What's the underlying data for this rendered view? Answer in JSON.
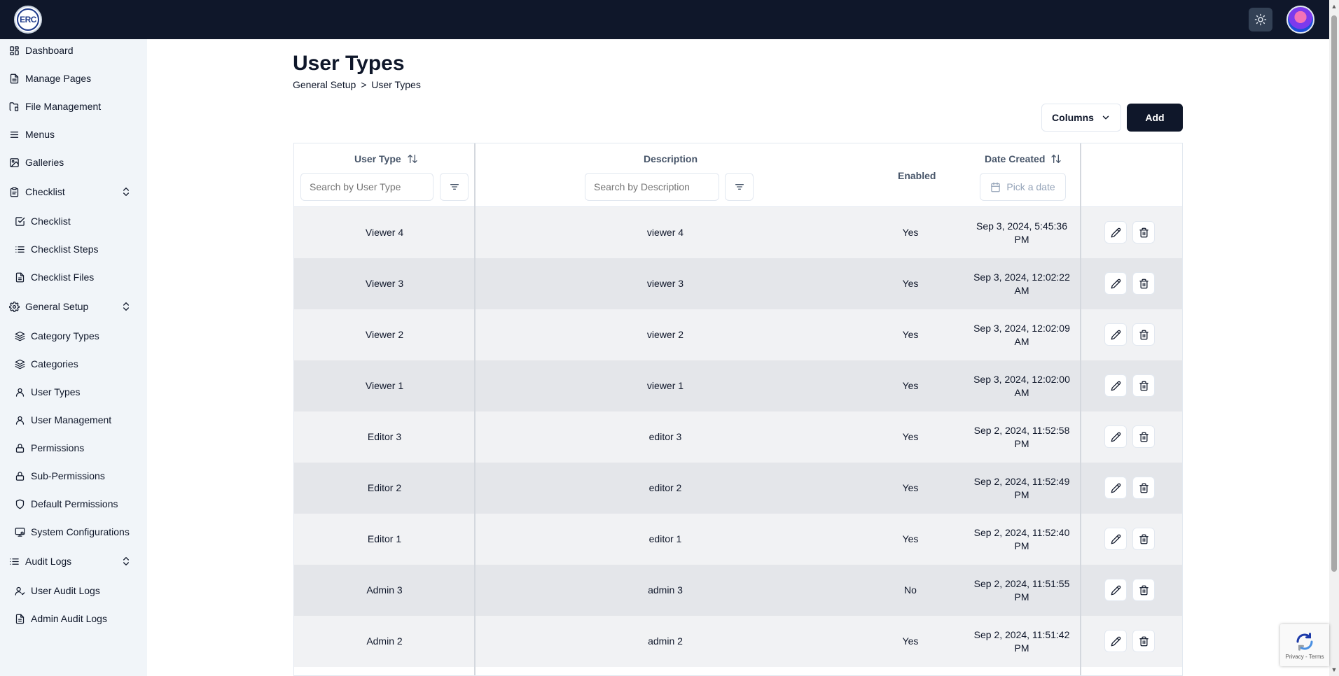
{
  "header": {
    "logo_text": "ERC"
  },
  "sidebar": {
    "items": [
      {
        "label": "Dashboard",
        "icon": "dashboard-icon"
      },
      {
        "label": "Manage Pages",
        "icon": "file-text-icon"
      },
      {
        "label": "File Management",
        "icon": "folder-file-icon"
      },
      {
        "label": "Menus",
        "icon": "menu-icon"
      },
      {
        "label": "Galleries",
        "icon": "image-icon"
      },
      {
        "label": "Checklist",
        "icon": "clipboard-icon",
        "expandable": true
      },
      {
        "label": "Checklist",
        "icon": "check-square-icon"
      },
      {
        "label": "Checklist Steps",
        "icon": "list-icon"
      },
      {
        "label": "Checklist Files",
        "icon": "file-icon"
      },
      {
        "label": "General Setup",
        "icon": "gear-icon",
        "expandable": true
      },
      {
        "label": "Category Types",
        "icon": "layers-icon"
      },
      {
        "label": "Categories",
        "icon": "layers-icon"
      },
      {
        "label": "User Types",
        "icon": "user-icon"
      },
      {
        "label": "User Management",
        "icon": "user-icon"
      },
      {
        "label": "Permissions",
        "icon": "lock-icon"
      },
      {
        "label": "Sub-Permissions",
        "icon": "lock-icon"
      },
      {
        "label": "Default Permissions",
        "icon": "shield-icon"
      },
      {
        "label": "System Configurations",
        "icon": "monitor-cog-icon"
      },
      {
        "label": "Audit Logs",
        "icon": "list-icon",
        "expandable": true
      },
      {
        "label": "User Audit Logs",
        "icon": "user-check-icon"
      },
      {
        "label": "Admin Audit Logs",
        "icon": "file-icon"
      }
    ]
  },
  "page": {
    "title": "User Types",
    "breadcrumb": {
      "parent": "General Setup",
      "separator": ">",
      "current": "User Types"
    }
  },
  "toolbar": {
    "columns_label": "Columns",
    "add_label": "Add"
  },
  "table": {
    "headers": {
      "user_type": "User Type",
      "description": "Description",
      "enabled": "Enabled",
      "date_created": "Date Created"
    },
    "filters": {
      "user_type_placeholder": "Search by User Type",
      "description_placeholder": "Search by Description",
      "date_placeholder": "Pick a date"
    },
    "rows": [
      {
        "user_type": "Viewer 4",
        "description": "viewer 4",
        "enabled": "Yes",
        "date_line1": "Sep 3, 2024, 5:45:36",
        "date_line2": "PM"
      },
      {
        "user_type": "Viewer 3",
        "description": "viewer 3",
        "enabled": "Yes",
        "date_line1": "Sep 3, 2024, 12:02:22",
        "date_line2": "AM"
      },
      {
        "user_type": "Viewer 2",
        "description": "viewer 2",
        "enabled": "Yes",
        "date_line1": "Sep 3, 2024, 12:02:09",
        "date_line2": "AM"
      },
      {
        "user_type": "Viewer 1",
        "description": "viewer 1",
        "enabled": "Yes",
        "date_line1": "Sep 3, 2024, 12:02:00",
        "date_line2": "AM"
      },
      {
        "user_type": "Editor 3",
        "description": "editor 3",
        "enabled": "Yes",
        "date_line1": "Sep 2, 2024, 11:52:58",
        "date_line2": "PM"
      },
      {
        "user_type": "Editor 2",
        "description": "editor 2",
        "enabled": "Yes",
        "date_line1": "Sep 2, 2024, 11:52:49",
        "date_line2": "PM"
      },
      {
        "user_type": "Editor 1",
        "description": "editor 1",
        "enabled": "Yes",
        "date_line1": "Sep 2, 2024, 11:52:40",
        "date_line2": "PM"
      },
      {
        "user_type": "Admin 3",
        "description": "admin 3",
        "enabled": "No",
        "date_line1": "Sep 2, 2024, 11:51:55",
        "date_line2": "PM"
      },
      {
        "user_type": "Admin 2",
        "description": "admin 2",
        "enabled": "Yes",
        "date_line1": "Sep 2, 2024, 11:51:42",
        "date_line2": "PM"
      }
    ]
  },
  "recaptcha": {
    "links": "Privacy - Terms"
  },
  "colors": {
    "topbar": "#0f172a",
    "sidebar": "#f1f5f9",
    "primary_button": "#0f172a",
    "row_light": "#f1f2f4",
    "row_dark": "#e4e6ea"
  }
}
